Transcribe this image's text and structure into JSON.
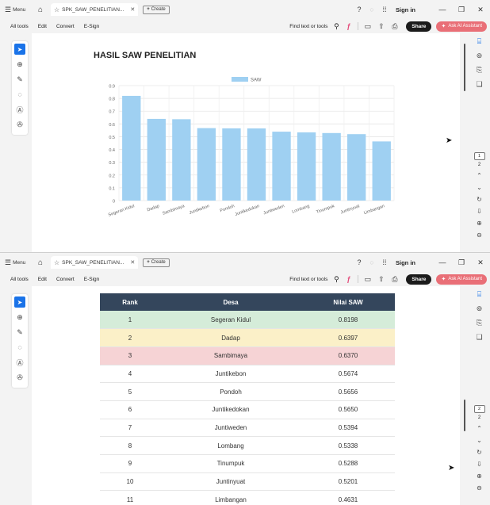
{
  "tabbar": {
    "menu_label": "Menu",
    "tab_title": "SPK_SAW_PENELITIAN...",
    "create_label": "Create",
    "sign_in": "Sign in"
  },
  "toolbar": {
    "all_tools": "All tools",
    "edit": "Edit",
    "convert": "Convert",
    "esign": "E-Sign",
    "find_label": "Find text or tools",
    "share_label": "Share",
    "ask_ai_label": "Ask AI Assistant"
  },
  "icons": {
    "menu": "hamburger-icon",
    "home": "home-icon",
    "star": "star-icon",
    "help": "help-icon",
    "apps": "apps-grid-icon",
    "select": "cursor-arrow-icon",
    "zoom": "zoom-icon",
    "draw": "pen-icon",
    "lasso": "lasso-icon",
    "textbox": "text-box-icon",
    "stamp": "stamp-icon",
    "search": "search-icon",
    "print": "print-icon",
    "upload": "upload-icon",
    "accent_share": "#1b1b1b",
    "accent_ai": "#e96f77",
    "accent_select": "#1a73e8"
  },
  "report": {
    "heading": "HASIL SAW PENELITIAN",
    "table_headers": [
      "Rank",
      "Desa",
      "Nilai SAW"
    ],
    "rows": [
      {
        "rank": "1",
        "desa": "Segeran Kidul",
        "nilai": "0.8198"
      },
      {
        "rank": "2",
        "desa": "Dadap",
        "nilai": "0.6397"
      },
      {
        "rank": "3",
        "desa": "Sambimaya",
        "nilai": "0.6370"
      },
      {
        "rank": "4",
        "desa": "Juntikebon",
        "nilai": "0.5674"
      },
      {
        "rank": "5",
        "desa": "Pondoh",
        "nilai": "0.5656"
      },
      {
        "rank": "6",
        "desa": "Juntikedokan",
        "nilai": "0.5650"
      },
      {
        "rank": "7",
        "desa": "Juntiweden",
        "nilai": "0.5394"
      },
      {
        "rank": "8",
        "desa": "Lombang",
        "nilai": "0.5338"
      },
      {
        "rank": "9",
        "desa": "Tinumpuk",
        "nilai": "0.5288"
      },
      {
        "rank": "10",
        "desa": "Juntinyuat",
        "nilai": "0.5201"
      },
      {
        "rank": "11",
        "desa": "Limbangan",
        "nilai": "0.4631"
      }
    ],
    "row_colors": {
      "rank1": "#d5ecd9",
      "rank2": "#fbf0c8",
      "rank3": "#f6d3d5",
      "header": "#34465c"
    }
  },
  "sidebar_right": {
    "page_box_top": "1",
    "page_count_top": "2",
    "page_box_bottom": "2",
    "page_count_bottom": "2"
  },
  "chart_data": {
    "type": "bar",
    "title": "",
    "categories": [
      "Segeran Kidul",
      "Dadap",
      "Sambimaya",
      "Juntikebon",
      "Pondoh",
      "Juntikedokan",
      "Juntiweden",
      "Lombang",
      "Tinumpuk",
      "Juntinyuat",
      "Limbangan"
    ],
    "series": [
      {
        "name": "SAW",
        "values": [
          0.8198,
          0.6397,
          0.637,
          0.5674,
          0.5656,
          0.565,
          0.5394,
          0.5338,
          0.5288,
          0.5201,
          0.4631
        ],
        "color": "#9fd0f2"
      }
    ],
    "ylim": [
      0,
      0.9
    ],
    "yticks": [
      "0",
      "0.1",
      "0.2",
      "0.3",
      "0.4",
      "0.5",
      "0.6",
      "0.7",
      "0.8",
      "0.9"
    ],
    "grid": true,
    "legend": "top-center"
  }
}
